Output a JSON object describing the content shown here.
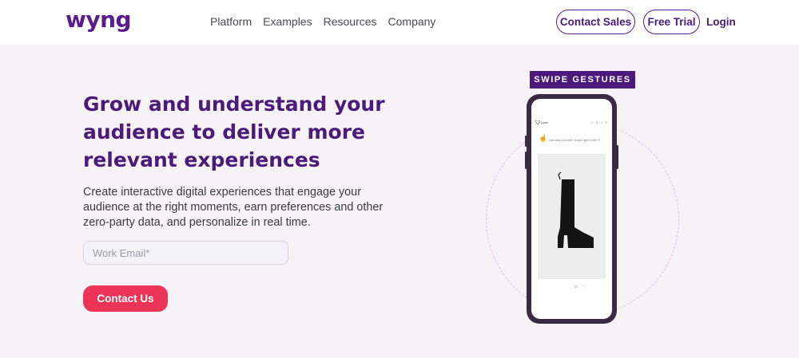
{
  "brand": {
    "logo": "wyng"
  },
  "nav": {
    "links": [
      "Platform",
      "Examples",
      "Resources",
      "Company"
    ],
    "contact_sales": "Contact Sales",
    "free_trial": "Free Trial",
    "login": "Login"
  },
  "hero": {
    "headline": "Grow and understand your audience to deliver more relevant experiences",
    "subtext": "Create interactive digital experiences that engage your audience at the right moments, earn preferences and other zero-party data, and personalize in real time.",
    "email_placeholder": "Work Email*",
    "cta": "Contact Us"
  },
  "phone": {
    "badge": "SWIPE GESTURES",
    "screen_brand": "Luxe",
    "screen_icons": "⌂ ♙ ○ ≡",
    "tip_icon": "☝",
    "tip_text": "Like what you see? Swipe right to like it!",
    "feedback_icons": "✕ ♡"
  },
  "colors": {
    "brand_purple": "#4c1a7a",
    "hero_bg": "#f6f2f6",
    "cta_red": "#ec3457"
  }
}
